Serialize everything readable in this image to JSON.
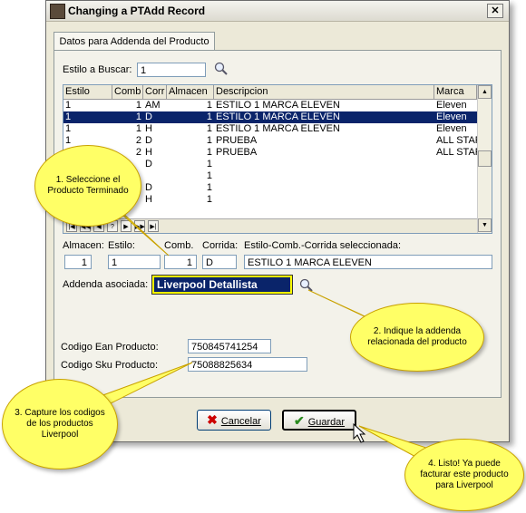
{
  "window": {
    "title": "Changing a PTAdd Record",
    "close": "✕"
  },
  "tab": {
    "label": "Datos para Addenda del Producto"
  },
  "search": {
    "label": "Estilo a Buscar:",
    "value": "1"
  },
  "grid": {
    "headers": [
      "Estilo",
      "Comb",
      "Corr",
      "Almacen",
      "Descripcion",
      "Marca"
    ],
    "rows": [
      [
        "1",
        "1",
        "AM",
        "1",
        "ESTILO 1 MARCA ELEVEN",
        "Eleven"
      ],
      [
        "1",
        "1",
        "D",
        "1",
        "ESTILO 1 MARCA ELEVEN",
        "Eleven"
      ],
      [
        "1",
        "1",
        "H",
        "1",
        "ESTILO 1 MARCA ELEVEN",
        "Eleven"
      ],
      [
        "1",
        "2",
        "D",
        "1",
        "PRUEBA",
        "ALL STAR"
      ],
      [
        "1",
        "2",
        "H",
        "1",
        "PRUEBA",
        "ALL STAR"
      ],
      [
        "",
        "",
        "D",
        "1",
        "",
        ""
      ],
      [
        "",
        "",
        "",
        "1",
        "",
        ""
      ],
      [
        "",
        "",
        "D",
        "1",
        "",
        ""
      ],
      [
        "",
        "",
        "H",
        "1",
        "",
        ""
      ]
    ],
    "nav": [
      "|◀",
      "◀◀",
      "◀",
      "?",
      "▶",
      "▶▶",
      "▶|"
    ]
  },
  "selection": {
    "almacen_label": "Almacen:",
    "almacen": "1",
    "estilo_label": "Estilo:",
    "estilo": "1",
    "comb_label": "Comb.",
    "comb": "1",
    "corrida_label": "Corrida:",
    "corrida": "D",
    "desc_label": "Estilo-Comb.-Corrida seleccionada:",
    "desc": "ESTILO 1 MARCA ELEVEN"
  },
  "addenda": {
    "label": "Addenda asociada:",
    "value": "Liverpool Detallista"
  },
  "ean": {
    "label": "Codigo Ean Producto:",
    "value": "750845741254"
  },
  "sku": {
    "label": "Codigo Sku Producto:",
    "value": "75088825634"
  },
  "buttons": {
    "cancel": "Cancelar",
    "save": "Guardar"
  },
  "callouts": {
    "c1": "1. Seleccione el Producto Terminado",
    "c2": "2. Indique la addenda relacionada del producto",
    "c3": "3. Capture los codigos de los productos Liverpool",
    "c4": "4. Listo! Ya puede facturar este producto para Liverpool"
  },
  "colors": {
    "selection": "#0a246a",
    "callout": "#ffff66",
    "addenda_bg": "#ffff00"
  }
}
